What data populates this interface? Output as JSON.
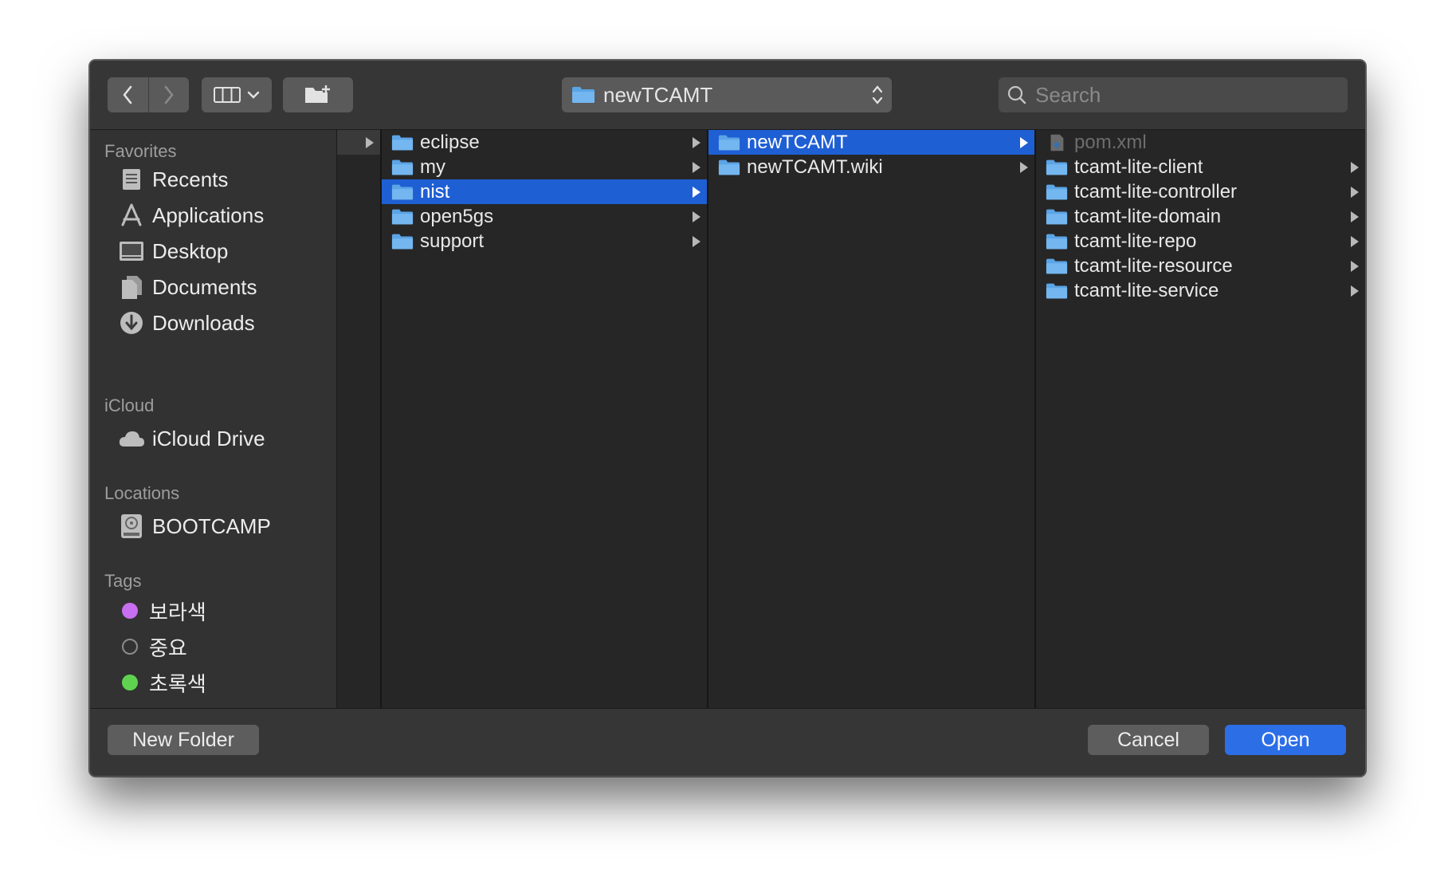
{
  "toolbar": {
    "path_label": "newTCAMT",
    "search_placeholder": "Search"
  },
  "sidebar": {
    "favorites_header": "Favorites",
    "favorites": [
      {
        "label": "Recents",
        "icon": "recents-icon"
      },
      {
        "label": "Applications",
        "icon": "applications-icon"
      },
      {
        "label": "Desktop",
        "icon": "desktop-icon"
      },
      {
        "label": "Documents",
        "icon": "documents-icon"
      },
      {
        "label": "Downloads",
        "icon": "downloads-icon"
      }
    ],
    "icloud_header": "iCloud",
    "icloud": [
      {
        "label": "iCloud Drive",
        "icon": "cloud-icon"
      }
    ],
    "locations_header": "Locations",
    "locations": [
      {
        "label": "BOOTCAMP",
        "icon": "disk-icon"
      }
    ],
    "tags_header": "Tags",
    "tags": [
      {
        "label": "보라색",
        "color": "#c86ef0"
      },
      {
        "label": "중요",
        "color": "#00000000"
      },
      {
        "label": "초록색",
        "color": "#5fd34f"
      }
    ]
  },
  "columns": {
    "col2": [
      {
        "label": "eclipse",
        "selected": false
      },
      {
        "label": "my",
        "selected": false
      },
      {
        "label": "nist",
        "selected": true
      },
      {
        "label": "open5gs",
        "selected": false
      },
      {
        "label": "support",
        "selected": false
      }
    ],
    "col3": [
      {
        "label": "newTCAMT",
        "selected": true
      },
      {
        "label": "newTCAMT.wiki",
        "selected": false
      }
    ],
    "col4": [
      {
        "label": "pom.xml",
        "type": "file",
        "disabled": true
      },
      {
        "label": "tcamt-lite-client",
        "type": "folder"
      },
      {
        "label": "tcamt-lite-controller",
        "type": "folder"
      },
      {
        "label": "tcamt-lite-domain",
        "type": "folder"
      },
      {
        "label": "tcamt-lite-repo",
        "type": "folder"
      },
      {
        "label": "tcamt-lite-resource",
        "type": "folder"
      },
      {
        "label": "tcamt-lite-service",
        "type": "folder"
      }
    ]
  },
  "buttons": {
    "new_folder": "New Folder",
    "cancel": "Cancel",
    "open": "Open"
  },
  "colors": {
    "accent": "#1f5fd4",
    "folder": "#5ba4e6"
  }
}
